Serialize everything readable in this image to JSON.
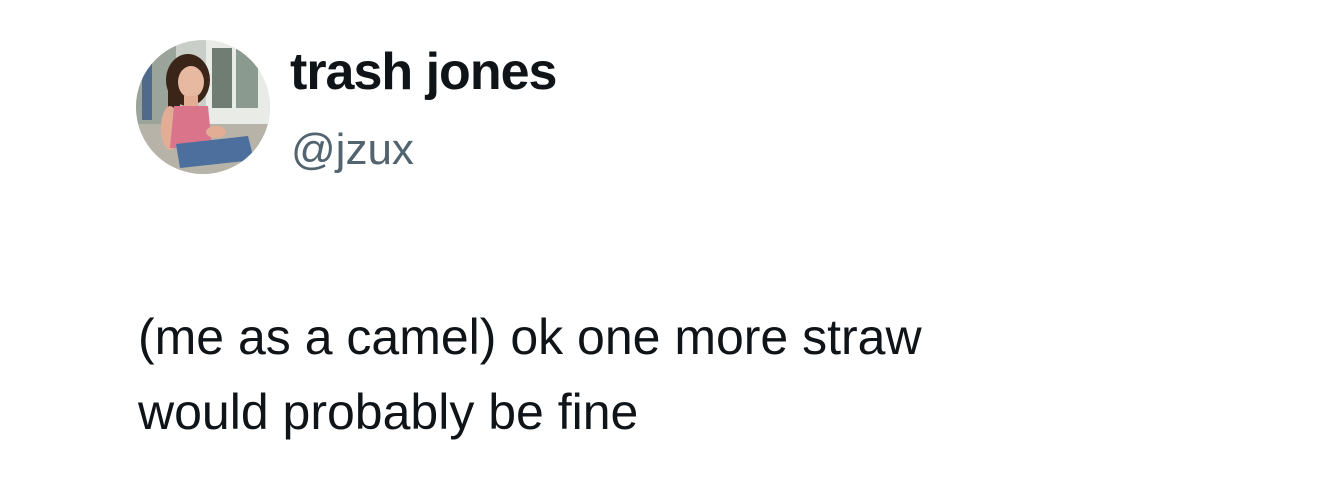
{
  "tweet": {
    "author": {
      "display_name": "trash jones",
      "handle": "@jzux"
    },
    "text_lines": [
      "(me as a camel) ok one more straw",
      "would probably be fine"
    ]
  },
  "colors": {
    "text": "#0f1419",
    "handle": "#536471",
    "background": "#ffffff"
  }
}
